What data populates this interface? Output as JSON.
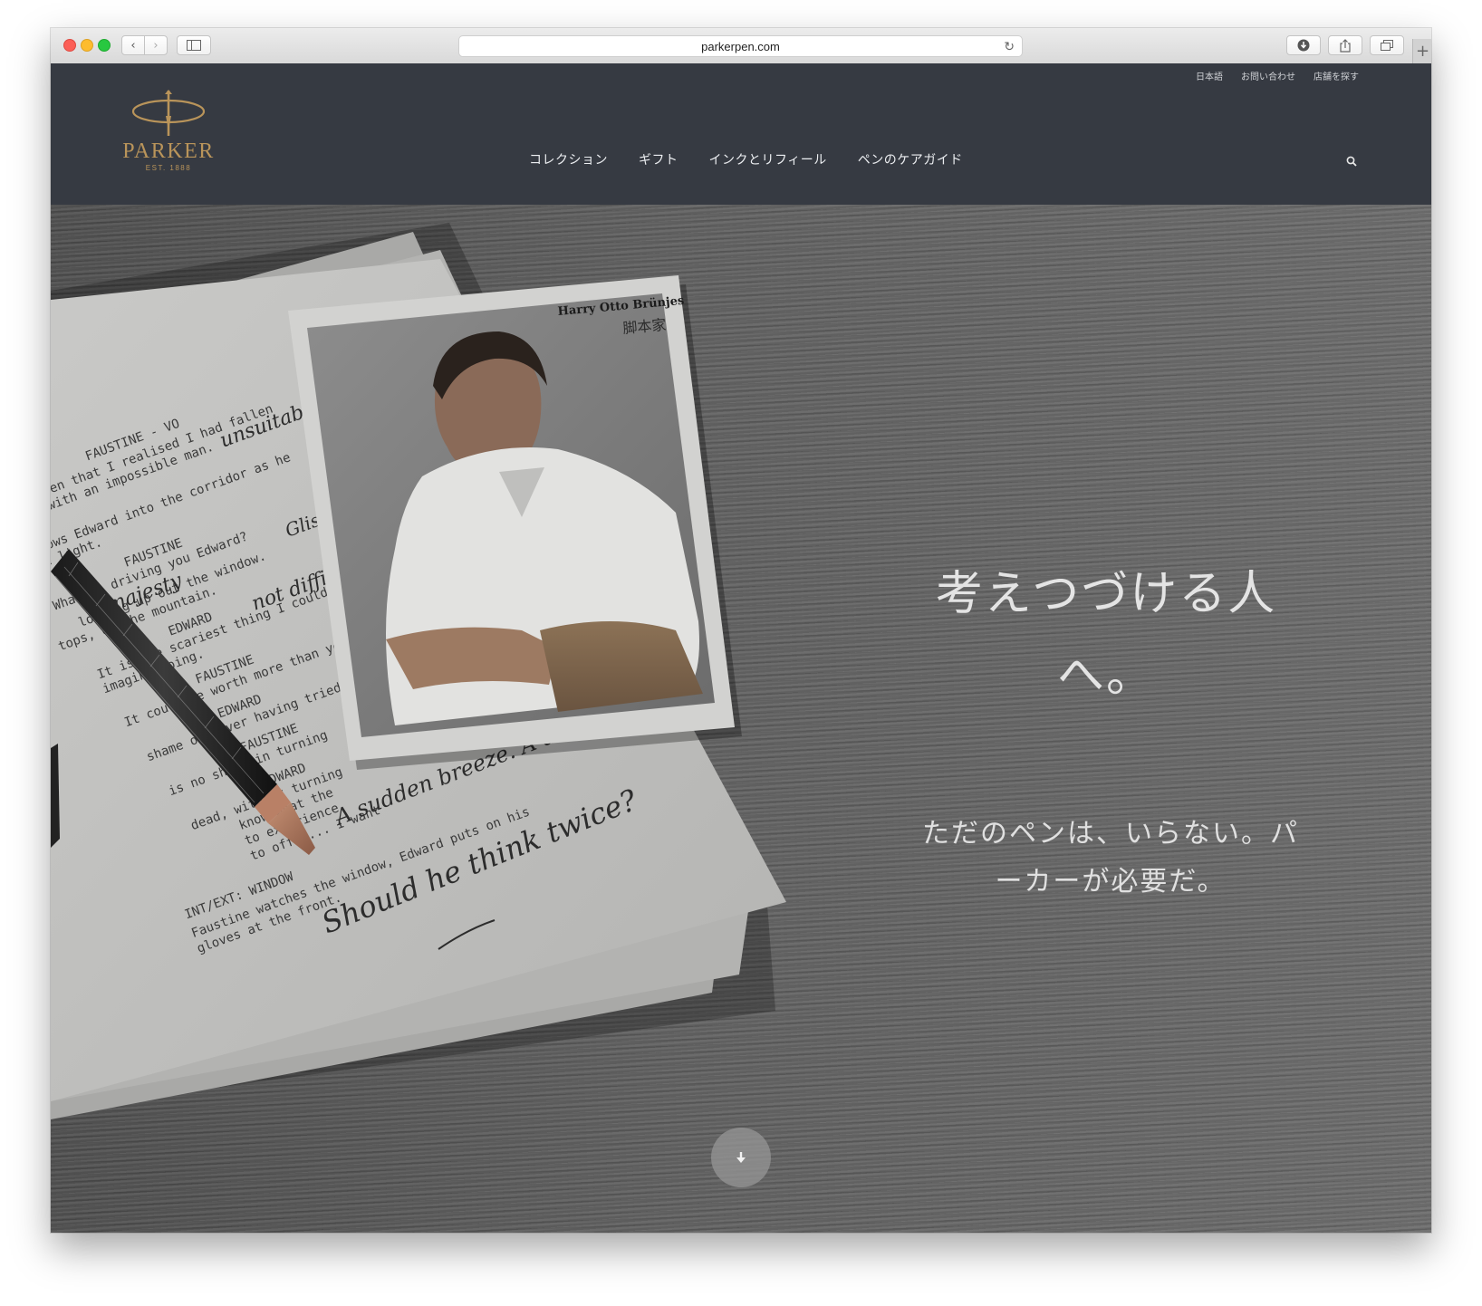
{
  "browser": {
    "url": "parkerpen.com"
  },
  "header": {
    "util_nav": [
      "日本語",
      "お問い合わせ",
      "店舗を探す"
    ],
    "logo": {
      "name": "PARKER",
      "est": "EST. 1888"
    },
    "main_nav": [
      "コレクション",
      "ギフト",
      "インクとリフィール",
      "ペンのケアガイド"
    ]
  },
  "hero": {
    "title_line1": "考えつづける人",
    "title_line2": "へ。",
    "sub_line1": "ただのペンは、いらない。パ",
    "sub_line2": "ーカーが必要だ。",
    "photo_caption_name": "Harry Otto Brünjes",
    "photo_caption_role": "脚本家",
    "script_lines": [
      "FAUSTINE - VO",
      "was then that I realised I had fallen",
      "love with an impossible man.",
      "allows Edward into the corridor as he",
      "the light.",
      "FAUSTINE",
      "What is driving you Edward?",
      "looking up out the window.",
      "tops, of the mountain.",
      "EDWARD",
      "It is the scariest thing I could",
      "imagine doing.",
      "FAUSTINE",
      "It could be worth more than you",
      "EDWARD",
      "shame of never having tried",
      "FAUSTINE",
      "is no shame in turning",
      "EDWARD",
      "dead, without turning",
      "know what the",
      "to experience",
      "to offer... I want",
      "INT/EXT: WINDOW",
      "Faustine watches the window, Edward puts on his",
      "gloves at the front."
    ],
    "handwriting": [
      "unsuitable",
      "Glistening",
      "majesty",
      "not difficult",
      "A sudden breeze. A dark cloud?",
      "Should he think twice?"
    ]
  },
  "icons": {
    "search": "search-icon",
    "scroll": "arrow-down-icon",
    "reload": "reload-icon",
    "download": "download-icon",
    "share": "share-icon",
    "tabs": "tabs-icon",
    "sidebar": "sidebar-icon"
  },
  "colors": {
    "header_bg": "#363a42",
    "logo_gold": "#b9945a",
    "hero_text": "#e4e4e4"
  }
}
